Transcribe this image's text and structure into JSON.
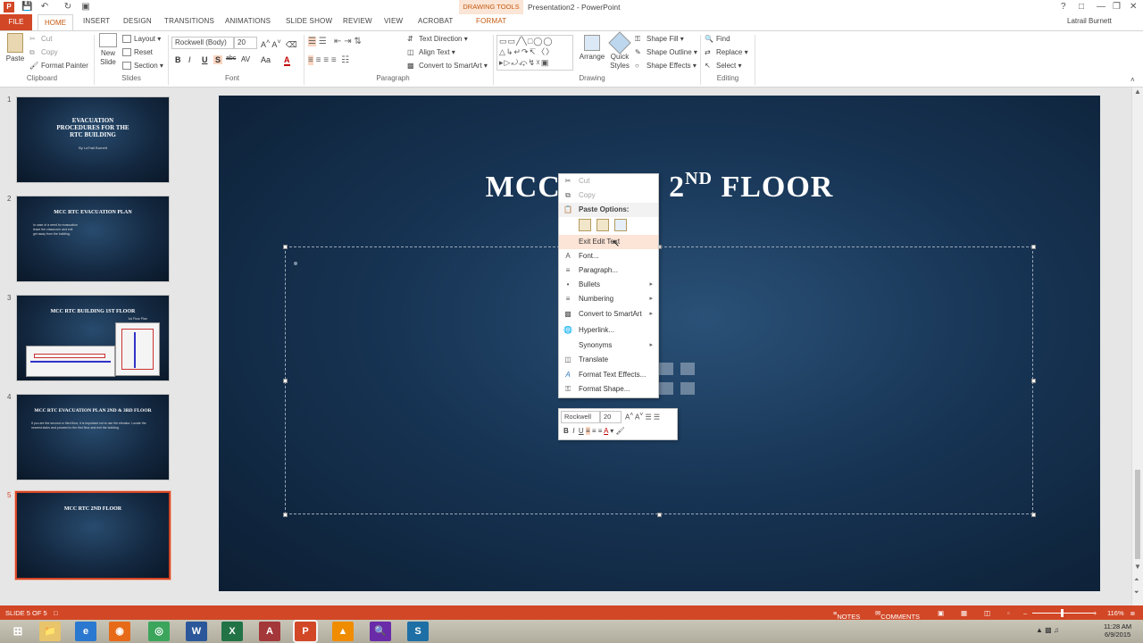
{
  "window": {
    "app_icon": "powerpoint-icon",
    "context_tab": "DRAWING TOOLS",
    "title": "Presentation2 - PowerPoint",
    "user": "Latrail Burnett"
  },
  "tabs": [
    "FILE",
    "HOME",
    "INSERT",
    "DESIGN",
    "TRANSITIONS",
    "ANIMATIONS",
    "SLIDE SHOW",
    "REVIEW",
    "VIEW",
    "ACROBAT",
    "FORMAT"
  ],
  "ribbon": {
    "clipboard": {
      "paste": "Paste",
      "cut": "Cut",
      "copy": "Copy",
      "format_painter": "Format Painter",
      "group": "Clipboard"
    },
    "slides": {
      "new_slide": "New Slide",
      "layout": "Layout",
      "reset": "Reset",
      "section": "Section",
      "group": "Slides"
    },
    "font": {
      "family": "Rockwell (Body)",
      "size": "20",
      "group": "Font",
      "buttons": [
        "B",
        "I",
        "U",
        "S",
        "abc",
        "AV",
        "Aa",
        "A"
      ]
    },
    "paragraph": {
      "text_direction": "Text Direction",
      "align_text": "Align Text",
      "convert_smartart": "Convert to SmartArt",
      "group": "Paragraph"
    },
    "drawing": {
      "arrange": "Arrange",
      "quick_styles": "Quick Styles",
      "shape_fill": "Shape Fill",
      "shape_outline": "Shape Outline",
      "shape_effects": "Shape Effects",
      "group": "Drawing"
    },
    "editing": {
      "find": "Find",
      "replace": "Replace",
      "select": "Select",
      "group": "Editing"
    }
  },
  "thumbnails": [
    {
      "num": "1",
      "title": "EVACUATION PROCEDURES FOR THE RTC BUILDING",
      "sub": "By LaTrail Burnett"
    },
    {
      "num": "2",
      "title": "MCC RTC EVACUATION PLAN",
      "body": "In case of a need for evacuation leave the classroom and exit get away from the building."
    },
    {
      "num": "3",
      "title": "MCC RTC BUILDING 1ST FLOOR",
      "sub": "1st Floor Plan"
    },
    {
      "num": "4",
      "title": "MCC RTC EVACUATION PLAN 2ND & 3RD FLOOR",
      "body": "If you are the second or third floor, it is important not to use the elevator. Locate the nearest stairs and proceed to the first floor and exit the building."
    },
    {
      "num": "5",
      "title": "MCC RTC 2ND FLOOR"
    }
  ],
  "slide": {
    "title_a": "MCC",
    "title_b": "2",
    "title_sup": "ND",
    "title_c": "FLOOR"
  },
  "context_menu": {
    "items": [
      {
        "label": "Cut",
        "icon": "scissors-icon",
        "disabled": true
      },
      {
        "label": "Copy",
        "icon": "copy-icon",
        "disabled": true
      },
      {
        "label": "Paste Options:",
        "icon": "paste-icon",
        "header": true
      },
      {
        "label": "Exit Edit Text",
        "icon": "",
        "highlight": true
      },
      {
        "label": "Font...",
        "icon": "font-icon"
      },
      {
        "label": "Paragraph...",
        "icon": "paragraph-icon"
      },
      {
        "label": "Bullets",
        "icon": "bullets-icon",
        "submenu": true
      },
      {
        "label": "Numbering",
        "icon": "numbering-icon",
        "submenu": true
      },
      {
        "label": "Convert to SmartArt",
        "icon": "smartart-icon",
        "submenu": true
      },
      {
        "label": "Hyperlink...",
        "icon": "hyperlink-icon"
      },
      {
        "label": "Synonyms",
        "icon": "",
        "submenu": true
      },
      {
        "label": "Translate",
        "icon": "translate-icon"
      },
      {
        "label": "Format Text Effects...",
        "icon": "text-effects-icon"
      },
      {
        "label": "Format Shape...",
        "icon": "format-shape-icon"
      }
    ]
  },
  "mini_toolbar": {
    "font": "Rockwell",
    "size": "20"
  },
  "status": {
    "slide": "SLIDE 5 OF 5",
    "notes": "NOTES",
    "comments": "COMMENTS",
    "zoom": "116%"
  },
  "taskbar": {
    "time": "11:28 AM",
    "date": "6/9/2015"
  },
  "colors": {
    "accent": "#d24726",
    "tab_accent": "#c55a11",
    "slide_bg": "#173454"
  }
}
